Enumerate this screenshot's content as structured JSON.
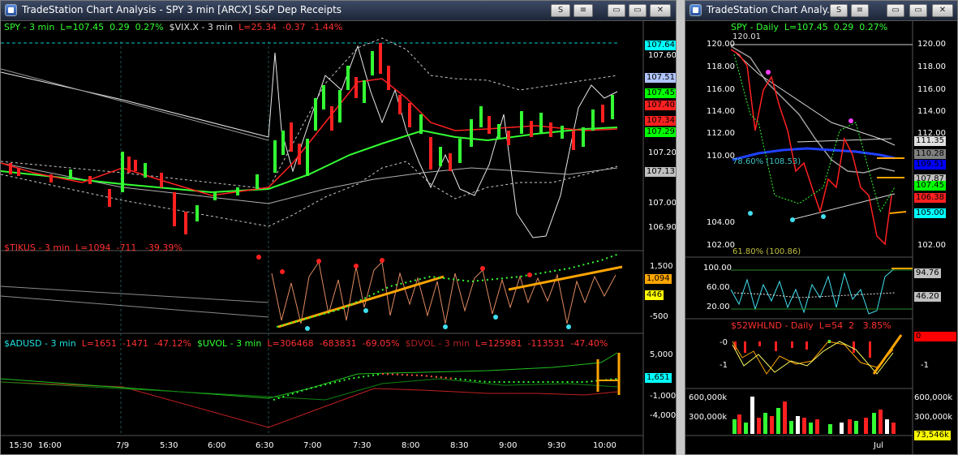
{
  "left": {
    "title": "TradeStation Chart Analysis  -  SPY 3 min [ARCX] S&P Dep Receipts",
    "buttons": {
      "s": "S",
      "lines": "≡",
      "min": "▭",
      "restore": "▭",
      "close": "✕"
    },
    "legend_spy": {
      "a": "SPY - 3 min",
      "b": "L=107.45",
      "c": "0.29",
      "d": "0.27%",
      "e": "$VIX.X - 3 min",
      "f": "L=25.34",
      "g": "-0.37",
      "h": "-1.44%"
    },
    "legend_tikus": {
      "a": "$TIKUS - 3 min",
      "b": "L=1094",
      "c": "-711",
      "d": "-39.39%"
    },
    "legend_adusd": {
      "a": "$ADUSD - 3 min",
      "b": "L=1651",
      "c": "-1471",
      "d": "-47.12%",
      "e": "$UVOL - 3 min",
      "f": "L=306468",
      "g": "-683831",
      "h": "-69.05%",
      "i": "$DVOL - 3 min",
      "j": "L=125981",
      "k": "-113531",
      "l": "-47.40%"
    },
    "price_axis": [
      "107.60",
      "107.20",
      "107.00",
      "106.90"
    ],
    "price_tags": [
      {
        "v": "107.64",
        "bg": "#00ffff"
      },
      {
        "v": "107.51",
        "bg": "#b0c4ff"
      },
      {
        "v": "107.45",
        "bg": "#00ff00"
      },
      {
        "v": "107.40",
        "bg": "#ff2020"
      },
      {
        "v": "107.34",
        "bg": "#ff2020"
      },
      {
        "v": "107.29",
        "bg": "#00ff00"
      },
      {
        "v": "107.13",
        "bg": "#c0c0c0"
      }
    ],
    "tik_axis": [
      "1,500",
      "-500"
    ],
    "tik_tags": [
      {
        "v": "1,094",
        "bg": "#ffa500"
      },
      {
        "v": "446",
        "bg": "#ffff00"
      }
    ],
    "ad_axis": [
      "5,000",
      "-1,000",
      "-4,000"
    ],
    "ad_tags": [
      {
        "v": "1,651",
        "bg": "#00ffff"
      }
    ],
    "time_axis": [
      "15:30",
      "16:00",
      "7/9",
      "5:30",
      "6:00",
      "6:30",
      "7:00",
      "7:30",
      "8:00",
      "8:30",
      "9:00",
      "9:30",
      "10:00"
    ]
  },
  "right": {
    "title": "TradeStation Chart Analy...",
    "legend_spy": {
      "a": "SPY - Daily",
      "b": "L=107.45",
      "c": "0.29",
      "d": "0.27%",
      "e": "120.01"
    },
    "price_axis": [
      "120.00",
      "118.00",
      "116.00",
      "114.00",
      "112.00",
      "110.00",
      "104.00",
      "102.00"
    ],
    "price_tags": [
      {
        "v": "111.35",
        "bg": "#e0e0e0"
      },
      {
        "v": "110.28",
        "bg": "#808080"
      },
      {
        "v": "109.51",
        "bg": "#0000ff"
      },
      {
        "v": "107.87",
        "bg": "#c0c0c0"
      },
      {
        "v": "107.45",
        "bg": "#00ff00"
      },
      {
        "v": "106.38",
        "bg": "#ff2020"
      },
      {
        "v": "105.00",
        "bg": "#00ffff"
      }
    ],
    "fib1": "78.60% (108.53)",
    "fib2": "61.80% (100.86)",
    "rsi_axis": [
      "100.00",
      "60.00",
      "20.00"
    ],
    "rsi_tags": [
      {
        "v": "94.76",
        "bg": "#c0c0c0"
      },
      {
        "v": "46.20",
        "bg": "#c0c0c0"
      }
    ],
    "whlnd_legend": {
      "a": "$52WHLND - Daily",
      "b": "L=54",
      "c": "2",
      "d": "3.85%"
    },
    "whlnd_axis": [
      "-0",
      "-1",
      "-1"
    ],
    "whlnd_tag": {
      "v": "0",
      "bg": "#ff0000"
    },
    "vol_axis_left": [
      "600,000k",
      "300,000k"
    ],
    "vol_axis_right": [
      "600,000k",
      "300,000k"
    ],
    "vol_tag": {
      "v": "73,546k",
      "bg": "#ffff00"
    },
    "time_axis": [
      "Jul"
    ]
  }
}
